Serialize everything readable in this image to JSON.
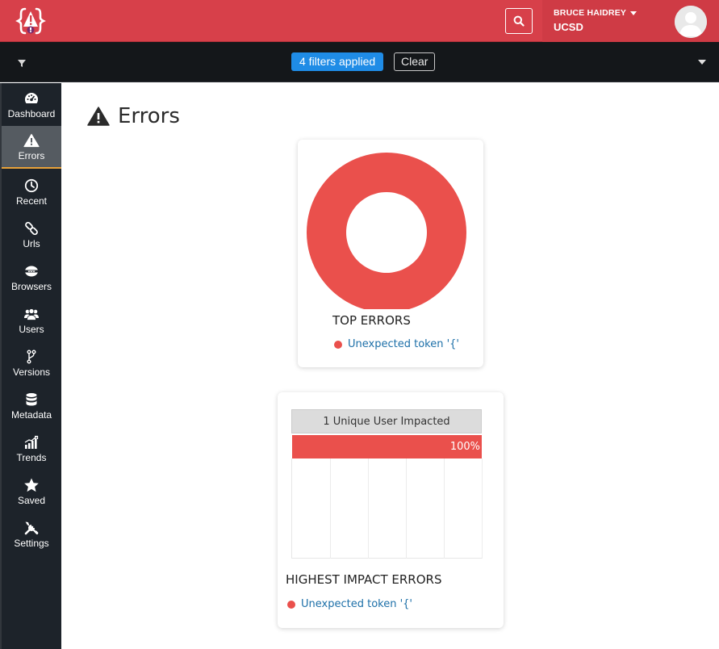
{
  "header": {
    "user_name": "BRUCE HAIDREY",
    "organization": "UCSD",
    "brand_color": "#d7404a"
  },
  "filterbar": {
    "filters_applied": "4 filters applied",
    "clear_label": "Clear"
  },
  "sidebar": {
    "items": [
      {
        "label": "Dashboard",
        "icon": "dashboard-icon",
        "active": false
      },
      {
        "label": "Errors",
        "icon": "warning-icon",
        "active": true
      },
      {
        "label": "Recent",
        "icon": "clock-icon",
        "active": false
      },
      {
        "label": "Urls",
        "icon": "link-icon",
        "active": false
      },
      {
        "label": "Browsers",
        "icon": "globe-icon",
        "active": false
      },
      {
        "label": "Users",
        "icon": "users-icon",
        "active": false
      },
      {
        "label": "Versions",
        "icon": "branch-icon",
        "active": false
      },
      {
        "label": "Metadata",
        "icon": "database-icon",
        "active": false
      },
      {
        "label": "Trends",
        "icon": "trends-icon",
        "active": false
      },
      {
        "label": "Saved",
        "icon": "star-icon",
        "active": false
      },
      {
        "label": "Settings",
        "icon": "tools-icon",
        "active": false
      }
    ]
  },
  "main": {
    "page_title": "Errors",
    "top_errors": {
      "title": "TOP ERRORS",
      "legend": "Unexpected token '{'",
      "color": "#ea504c"
    },
    "highest_impact": {
      "title": "HIGHEST IMPACT ERRORS",
      "header": "1 Unique User Impacted",
      "bar_label": "100%",
      "legend": "Unexpected token '{'",
      "color": "#ea504c"
    }
  },
  "chart_data": [
    {
      "type": "pie",
      "title": "TOP ERRORS",
      "categories": [
        "Unexpected token '{'"
      ],
      "values": [
        100
      ]
    },
    {
      "type": "bar",
      "title": "HIGHEST IMPACT ERRORS",
      "header": "1 Unique User Impacted",
      "categories": [
        "Unexpected token '{'"
      ],
      "values": [
        100
      ],
      "ylim": [
        0,
        100
      ],
      "data_labels": [
        "100%"
      ]
    }
  ]
}
